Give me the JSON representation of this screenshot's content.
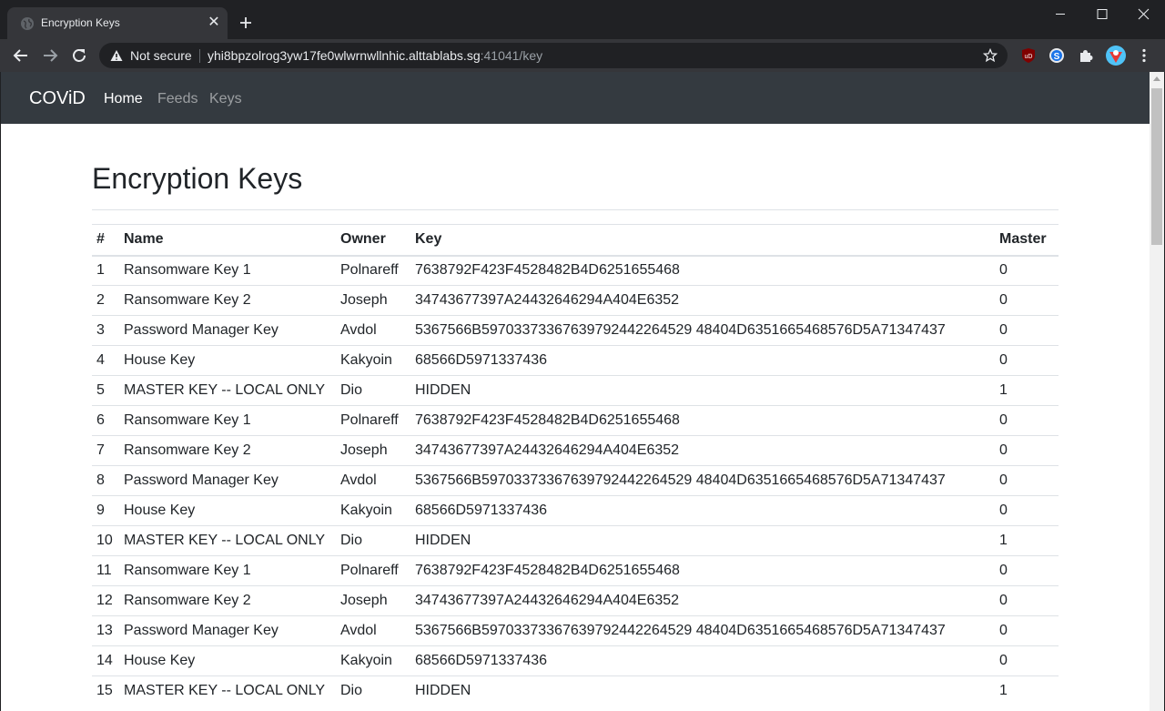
{
  "browser": {
    "tab_title": "Encryption Keys",
    "security_label": "Not secure",
    "url_host": "yhi8bpzolrog3yw17fe0wlwrnwllnhic.alttablabs.sg",
    "url_rest": ":41041/key"
  },
  "navbar": {
    "brand": "COViD",
    "links": [
      "Home",
      "Feeds",
      "Keys"
    ]
  },
  "page": {
    "title": "Encryption Keys"
  },
  "table": {
    "headers": [
      "#",
      "Name",
      "Owner",
      "Key",
      "Master"
    ],
    "rows": [
      [
        "1",
        "Ransomware Key 1",
        "Polnareff",
        "7638792F423F4528482B4D6251655468",
        "0"
      ],
      [
        "2",
        "Ransomware Key 2",
        "Joseph",
        "34743677397A24432646294A404E6352",
        "0"
      ],
      [
        "3",
        "Password Manager Key",
        "Avdol",
        "5367566B59703373367639792442264529 48404D6351665468576D5A71347437",
        "0"
      ],
      [
        "4",
        "House Key",
        "Kakyoin",
        "68566D5971337436",
        "0"
      ],
      [
        "5",
        "MASTER KEY -- LOCAL ONLY",
        "Dio",
        "HIDDEN",
        "1"
      ],
      [
        "6",
        "Ransomware Key 1",
        "Polnareff",
        "7638792F423F4528482B4D6251655468",
        "0"
      ],
      [
        "7",
        "Ransomware Key 2",
        "Joseph",
        "34743677397A24432646294A404E6352",
        "0"
      ],
      [
        "8",
        "Password Manager Key",
        "Avdol",
        "5367566B59703373367639792442264529 48404D6351665468576D5A71347437",
        "0"
      ],
      [
        "9",
        "House Key",
        "Kakyoin",
        "68566D5971337436",
        "0"
      ],
      [
        "10",
        "MASTER KEY -- LOCAL ONLY",
        "Dio",
        "HIDDEN",
        "1"
      ],
      [
        "11",
        "Ransomware Key 1",
        "Polnareff",
        "7638792F423F4528482B4D6251655468",
        "0"
      ],
      [
        "12",
        "Ransomware Key 2",
        "Joseph",
        "34743677397A24432646294A404E6352",
        "0"
      ],
      [
        "13",
        "Password Manager Key",
        "Avdol",
        "5367566B59703373367639792442264529 48404D6351665468576D5A71347437",
        "0"
      ],
      [
        "14",
        "House Key",
        "Kakyoin",
        "68566D5971337436",
        "0"
      ],
      [
        "15",
        "MASTER KEY -- LOCAL ONLY",
        "Dio",
        "HIDDEN",
        "1"
      ]
    ]
  }
}
